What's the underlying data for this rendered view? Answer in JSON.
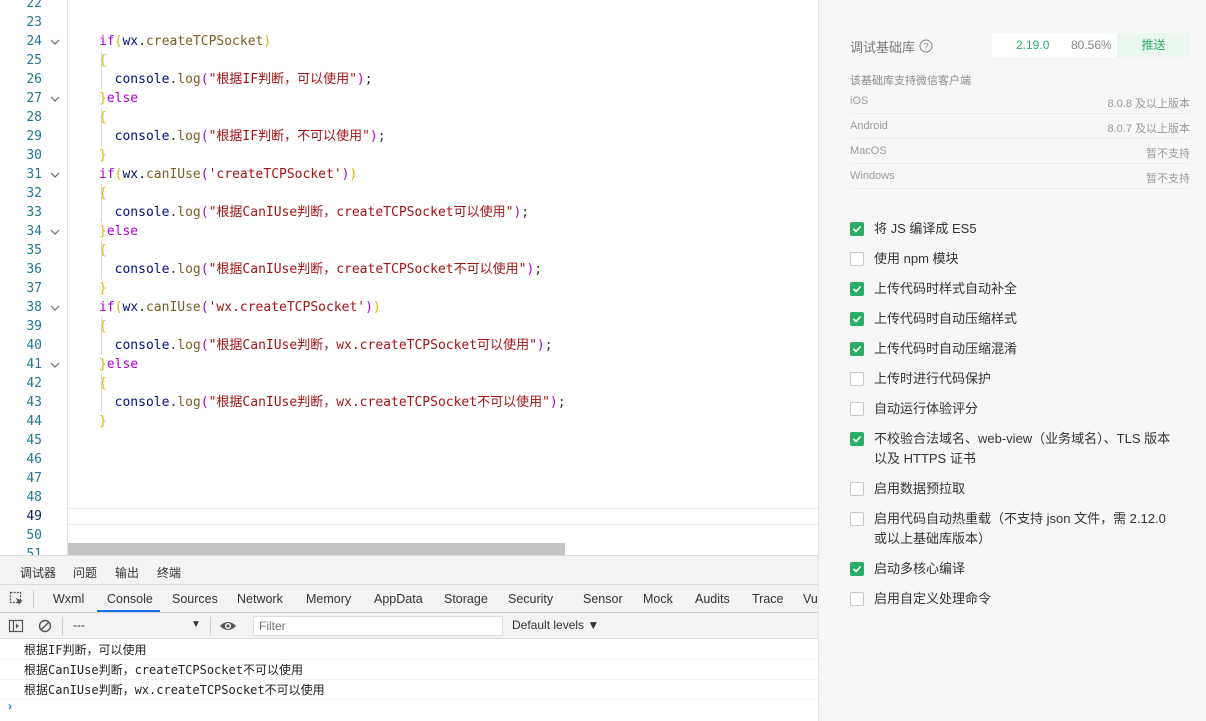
{
  "editor": {
    "lines": [
      {
        "n": "22",
        "fold": false,
        "tokens": []
      },
      {
        "n": "23",
        "fold": false,
        "tokens": []
      },
      {
        "n": "24",
        "fold": true,
        "tokens": [
          [
            "kw",
            "if"
          ],
          [
            "b1",
            "("
          ],
          [
            "obj",
            "wx"
          ],
          [
            "",
            "."
          ],
          [
            "fn",
            "createTCPSocket"
          ],
          [
            "b1",
            ")"
          ]
        ]
      },
      {
        "n": "25",
        "fold": false,
        "tokens": [
          [
            "b1",
            "{"
          ]
        ]
      },
      {
        "n": "26",
        "fold": false,
        "tokens": [
          [
            "",
            "  "
          ],
          [
            "obj",
            "console"
          ],
          [
            "",
            "."
          ],
          [
            "fn",
            "log"
          ],
          [
            "b2",
            "("
          ],
          [
            "str",
            "\"根据IF判断，可以使用\""
          ],
          [
            "b2",
            ")"
          ],
          [
            "",
            ";"
          ]
        ]
      },
      {
        "n": "27",
        "fold": true,
        "tokens": [
          [
            "b1",
            "}"
          ],
          [
            "kw",
            "else"
          ]
        ]
      },
      {
        "n": "28",
        "fold": false,
        "tokens": [
          [
            "b1",
            "{"
          ]
        ]
      },
      {
        "n": "29",
        "fold": false,
        "tokens": [
          [
            "",
            "  "
          ],
          [
            "obj",
            "console"
          ],
          [
            "",
            "."
          ],
          [
            "fn",
            "log"
          ],
          [
            "b2",
            "("
          ],
          [
            "str",
            "\"根据IF判断，不可以使用\""
          ],
          [
            "b2",
            ")"
          ],
          [
            "",
            ";"
          ]
        ]
      },
      {
        "n": "30",
        "fold": false,
        "tokens": [
          [
            "b1",
            "}"
          ]
        ]
      },
      {
        "n": "31",
        "fold": true,
        "tokens": [
          [
            "kw",
            "if"
          ],
          [
            "b1",
            "("
          ],
          [
            "obj",
            "wx"
          ],
          [
            "",
            "."
          ],
          [
            "fn",
            "canIUse"
          ],
          [
            "b2",
            "("
          ],
          [
            "str",
            "'createTCPSocket'"
          ],
          [
            "b2",
            ")"
          ],
          [
            "b1",
            ")"
          ]
        ]
      },
      {
        "n": "32",
        "fold": false,
        "tokens": [
          [
            "b1",
            "{"
          ]
        ]
      },
      {
        "n": "33",
        "fold": false,
        "tokens": [
          [
            "",
            "  "
          ],
          [
            "obj",
            "console"
          ],
          [
            "",
            "."
          ],
          [
            "fn",
            "log"
          ],
          [
            "b2",
            "("
          ],
          [
            "str",
            "\"根据CanIUse判断，createTCPSocket可以使用\""
          ],
          [
            "b2",
            ")"
          ],
          [
            "",
            ";"
          ]
        ]
      },
      {
        "n": "34",
        "fold": true,
        "tokens": [
          [
            "b1",
            "}"
          ],
          [
            "kw",
            "else"
          ]
        ]
      },
      {
        "n": "35",
        "fold": false,
        "tokens": [
          [
            "b1",
            "{"
          ]
        ]
      },
      {
        "n": "36",
        "fold": false,
        "tokens": [
          [
            "",
            "  "
          ],
          [
            "obj",
            "console"
          ],
          [
            "",
            "."
          ],
          [
            "fn",
            "log"
          ],
          [
            "b2",
            "("
          ],
          [
            "str",
            "\"根据CanIUse判断，createTCPSocket不可以使用\""
          ],
          [
            "b2",
            ")"
          ],
          [
            "",
            ";"
          ]
        ]
      },
      {
        "n": "37",
        "fold": false,
        "tokens": [
          [
            "b1",
            "}"
          ]
        ]
      },
      {
        "n": "38",
        "fold": true,
        "tokens": [
          [
            "kw",
            "if"
          ],
          [
            "b1",
            "("
          ],
          [
            "obj",
            "wx"
          ],
          [
            "",
            "."
          ],
          [
            "fn",
            "canIUse"
          ],
          [
            "b2",
            "("
          ],
          [
            "str",
            "'wx.createTCPSocket'"
          ],
          [
            "b2",
            ")"
          ],
          [
            "b1",
            ")"
          ]
        ]
      },
      {
        "n": "39",
        "fold": false,
        "tokens": [
          [
            "b1",
            "{"
          ]
        ]
      },
      {
        "n": "40",
        "fold": false,
        "tokens": [
          [
            "",
            "  "
          ],
          [
            "obj",
            "console"
          ],
          [
            "",
            "."
          ],
          [
            "fn",
            "log"
          ],
          [
            "b2",
            "("
          ],
          [
            "str",
            "\"根据CanIUse判断，wx.createTCPSocket可以使用\""
          ],
          [
            "b2",
            ")"
          ],
          [
            "",
            ";"
          ]
        ]
      },
      {
        "n": "41",
        "fold": true,
        "tokens": [
          [
            "b1",
            "}"
          ],
          [
            "kw",
            "else"
          ]
        ]
      },
      {
        "n": "42",
        "fold": false,
        "tokens": [
          [
            "b1",
            "{"
          ]
        ]
      },
      {
        "n": "43",
        "fold": false,
        "tokens": [
          [
            "",
            "  "
          ],
          [
            "obj",
            "console"
          ],
          [
            "",
            "."
          ],
          [
            "fn",
            "log"
          ],
          [
            "b2",
            "("
          ],
          [
            "str",
            "\"根据CanIUse判断，wx.createTCPSocket不可以使用\""
          ],
          [
            "b2",
            ")"
          ],
          [
            "",
            ";"
          ]
        ]
      },
      {
        "n": "44",
        "fold": false,
        "tokens": [
          [
            "b1",
            "}"
          ]
        ]
      },
      {
        "n": "45",
        "fold": false,
        "tokens": []
      },
      {
        "n": "46",
        "fold": false,
        "tokens": []
      },
      {
        "n": "47",
        "fold": false,
        "tokens": []
      },
      {
        "n": "48",
        "fold": false,
        "tokens": []
      },
      {
        "n": "49",
        "fold": false,
        "current": true,
        "tokens": []
      },
      {
        "n": "50",
        "fold": false,
        "tokens": []
      },
      {
        "n": "51",
        "fold": false,
        "tokens": []
      }
    ]
  },
  "devtools": {
    "top_tabs": [
      "调试器",
      "问题",
      "输出",
      "终端"
    ],
    "panel_tabs": [
      "Wxml",
      "Console",
      "Sources",
      "Network",
      "Memory",
      "AppData",
      "Storage",
      "Security",
      "Sensor",
      "Mock",
      "Audits",
      "Trace",
      "Vu"
    ],
    "active_panel": "Console",
    "context": "---",
    "filter_placeholder": "Filter",
    "levels": "Default levels ▼",
    "console_lines": [
      "根据IF判断，可以使用",
      "根据CanIUse判断，createTCPSocket不可以使用",
      "根据CanIUse判断，wx.createTCPSocket不可以使用"
    ],
    "prompt": "›"
  },
  "settings": {
    "lib_label": "调试基础库",
    "lib_version": "2.19.0",
    "lib_percent": "80.56%",
    "push_label": "推送",
    "support_title": "该基础库支持微信客户端",
    "platforms": [
      {
        "name": "iOS",
        "value": "8.0.8 及以上版本"
      },
      {
        "name": "Android",
        "value": "8.0.7 及以上版本"
      },
      {
        "name": "MacOS",
        "value": "暂不支持"
      },
      {
        "name": "Windows",
        "value": "暂不支持"
      }
    ],
    "options": [
      {
        "label": "将 JS 编译成 ES5",
        "checked": true
      },
      {
        "label": "使用 npm 模块",
        "checked": false
      },
      {
        "label": "上传代码时样式自动补全",
        "checked": true
      },
      {
        "label": "上传代码时自动压缩样式",
        "checked": true
      },
      {
        "label": "上传代码时自动压缩混淆",
        "checked": true
      },
      {
        "label": "上传时进行代码保护",
        "checked": false
      },
      {
        "label": "自动运行体验评分",
        "checked": false
      },
      {
        "label": "不校验合法域名、web-view（业务域名）、TLS 版本以及 HTTPS 证书",
        "checked": true
      },
      {
        "label": "启用数据预拉取",
        "checked": false
      },
      {
        "label": "启用代码自动热重载（不支持 json 文件，需 2.12.0 或以上基础库版本）",
        "checked": false
      },
      {
        "label": "启动多核心编译",
        "checked": true
      },
      {
        "label": "启用自定义处理命令",
        "checked": false
      }
    ]
  },
  "colors": {
    "accent_green": "#2aae67",
    "tab_underline": "#1a73e8"
  }
}
